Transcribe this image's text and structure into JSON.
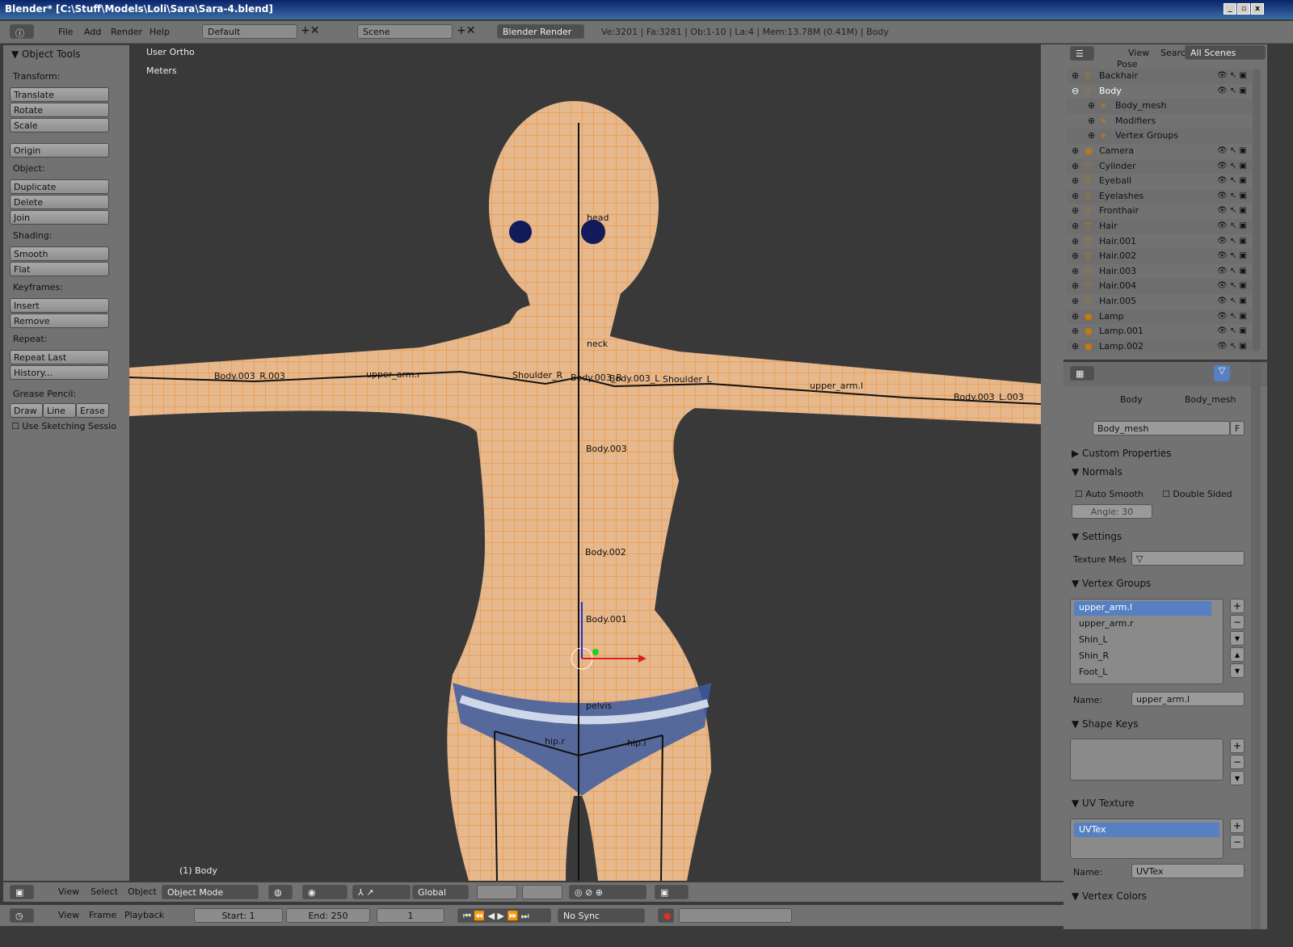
{
  "window": {
    "title": "Blender* [C:\\Stuff\\Models\\Loli\\Sara\\Sara-4.blend]"
  },
  "topbar": {
    "menus": [
      "File",
      "Add",
      "Render",
      "Help"
    ],
    "screen": "Default",
    "scene": "Scene",
    "engine": "Blender Render",
    "stats": "Ve:3201 | Fa:3281 | Ob:1-10 | La:4 | Mem:13.78M (0.41M) | Body"
  },
  "toolshelf": {
    "title": "Object Tools",
    "sections": [
      {
        "label": "Transform:",
        "buttons": [
          "Translate",
          "Rotate",
          "Scale"
        ]
      },
      {
        "label": "",
        "buttons": [
          "Origin"
        ]
      },
      {
        "label": "Object:",
        "buttons": [
          "Duplicate",
          "Delete",
          "Join"
        ]
      },
      {
        "label": "Shading:",
        "buttons": [
          "Smooth",
          "Flat"
        ]
      },
      {
        "label": "Keyframes:",
        "buttons": [
          "Insert",
          "Remove"
        ]
      },
      {
        "label": "Repeat:",
        "buttons": [
          "Repeat Last",
          "History..."
        ]
      }
    ],
    "grease_label": "Grease Pencil:",
    "grease_buttons": [
      "Draw",
      "Line",
      "Erase"
    ],
    "sketching": "Use Sketching Sessio"
  },
  "viewport": {
    "view_name": "User Ortho",
    "units": "Meters",
    "object_info": "(1) Body",
    "bones": [
      "head",
      "neck",
      "Body.003_R.003",
      "upper_arm.r",
      "Shoulder_R",
      "Body.003_R",
      "Body.003_L",
      "Shoulder_L",
      "upper_arm.l",
      "Body.003_L.003",
      "Body.003",
      "Body.002",
      "Body.001",
      "pelvis",
      "hip.r",
      "hip.l"
    ],
    "colors": {
      "wire": "#f0902a",
      "skin": "#e8b98c",
      "background": "#393939"
    }
  },
  "outliner": {
    "menus": [
      "View",
      "Search"
    ],
    "filter": "All Scenes",
    "partial_top": "Pose",
    "rows": [
      {
        "name": "Backhair",
        "type": "mesh"
      },
      {
        "name": "Body",
        "type": "mesh",
        "expanded": true,
        "selected": true
      },
      {
        "name": "Body_mesh",
        "type": "child"
      },
      {
        "name": "Modifiers",
        "type": "child"
      },
      {
        "name": "Vertex Groups",
        "type": "child"
      },
      {
        "name": "Camera",
        "type": "camera"
      },
      {
        "name": "Cylinder",
        "type": "mesh"
      },
      {
        "name": "Eyeball",
        "type": "mesh"
      },
      {
        "name": "Eyelashes",
        "type": "mesh"
      },
      {
        "name": "Fronthair",
        "type": "mesh"
      },
      {
        "name": "Hair",
        "type": "mesh"
      },
      {
        "name": "Hair.001",
        "type": "mesh"
      },
      {
        "name": "Hair.002",
        "type": "mesh"
      },
      {
        "name": "Hair.003",
        "type": "mesh"
      },
      {
        "name": "Hair.004",
        "type": "mesh"
      },
      {
        "name": "Hair.005",
        "type": "mesh"
      },
      {
        "name": "Lamp",
        "type": "lamp"
      },
      {
        "name": "Lamp.001",
        "type": "lamp"
      },
      {
        "name": "Lamp.002",
        "type": "lamp"
      }
    ]
  },
  "properties": {
    "breadcrumb": [
      "Body",
      "Body_mesh"
    ],
    "mesh_name": "Body_mesh",
    "fake_user": "F",
    "custom_properties": "Custom Properties",
    "normals": "Normals",
    "auto_smooth": "Auto Smooth",
    "double_sided": "Double Sided",
    "angle": "Angle: 30",
    "settings": "Settings",
    "texture_mesh_label": "Texture Mes",
    "vertex_groups": "Vertex Groups",
    "groups": [
      "upper_arm.l",
      "upper_arm.r",
      "Shin_L",
      "Shin_R",
      "Foot_L"
    ],
    "name_label": "Name:",
    "group_name": "upper_arm.l",
    "shape_keys": "Shape Keys",
    "uv_texture": "UV Texture",
    "uv_items": [
      "UVTex"
    ],
    "uv_name": "UVTex",
    "vertex_colors": "Vertex Colors"
  },
  "view3d_header": {
    "menus": [
      "View",
      "Select",
      "Object"
    ],
    "mode": "Object Mode",
    "orientation": "Global"
  },
  "timeline": {
    "menus": [
      "View",
      "Frame",
      "Playback"
    ],
    "start": "Start: 1",
    "end": "End: 250",
    "frame": "1",
    "sync": "No Sync"
  }
}
